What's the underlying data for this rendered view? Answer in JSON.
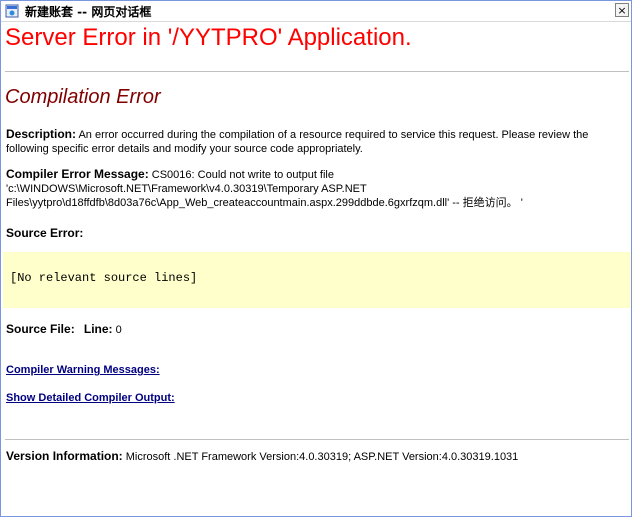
{
  "window": {
    "title": "新建账套 -- 网页对话框",
    "close_label": "×"
  },
  "page": {
    "error_title": "Server Error in '/YYTPRO' Application.",
    "section_title": "Compilation Error",
    "description_label": "Description:",
    "description_text": " An error occurred during the compilation of a resource required to service this request. Please review the following specific error details and modify your source code appropriately.",
    "compiler_msg_label": "Compiler Error Message:",
    "compiler_msg_text": " CS0016: Could not write to output file 'c:\\WINDOWS\\Microsoft.NET\\Framework\\v4.0.30319\\Temporary ASP.NET Files\\yytpro\\d18ffdfb\\8d03a76c\\App_Web_createaccountmain.aspx.299ddbde.6gxrfzqm.dll' -- 拒绝访问。 '",
    "source_error_label": "Source Error:",
    "source_code": "[No relevant source lines]",
    "source_file_label": "Source File:",
    "line_label": "Line:",
    "line_value": "0",
    "warning_link": "Compiler Warning Messages:",
    "detail_link": "Show Detailed Compiler Output:",
    "version_label": "Version Information:",
    "version_text": " Microsoft .NET Framework Version:4.0.30319; ASP.NET Version:4.0.30319.1031"
  },
  "colors": {
    "error_title": "#ff0000",
    "section_title": "#800000",
    "source_box_bg": "#ffffcc",
    "link": "#000080"
  },
  "icons": {
    "app": "ie-page-icon",
    "close": "close-icon"
  }
}
